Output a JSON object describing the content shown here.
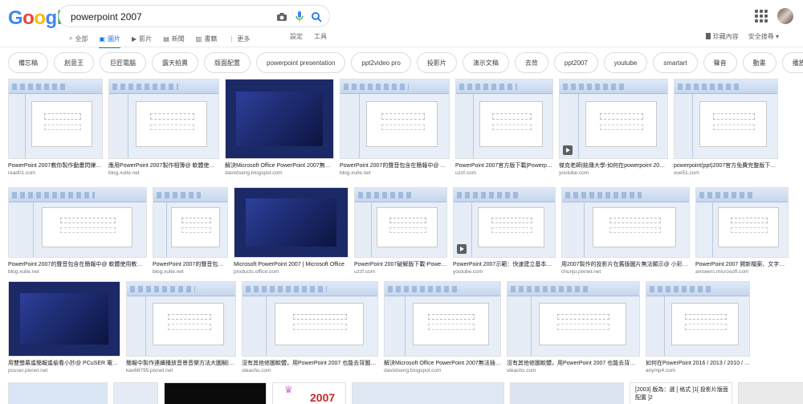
{
  "search": {
    "query": "powerpoint 2007"
  },
  "logo": {
    "letters": [
      "G",
      "o",
      "o",
      "g",
      "l",
      "e"
    ],
    "colors": [
      "#4285f4",
      "#ea4335",
      "#fbbc05",
      "#4285f4",
      "#34a853",
      "#ea4335"
    ]
  },
  "tabs": [
    {
      "label": "全部",
      "icon": "search-icon",
      "active": false
    },
    {
      "label": "圖片",
      "icon": "image-icon",
      "active": true
    },
    {
      "label": "影片",
      "icon": "video-icon",
      "active": false
    },
    {
      "label": "新聞",
      "icon": "news-icon",
      "active": false
    },
    {
      "label": "書籍",
      "icon": "book-icon",
      "active": false
    },
    {
      "label": "更多",
      "icon": "more-icon",
      "active": false
    }
  ],
  "tools": {
    "settings": "設定",
    "tools": "工具"
  },
  "right_links": {
    "saved": "珍藏內容",
    "safesearch": "安全搜尋"
  },
  "chips": [
    "備忘稿",
    "創意王",
    "巨匠電腦",
    "露天拍賣",
    "版面配置",
    "powerpoint presentation",
    "ppt2video pro",
    "投影片",
    "演示文稿",
    "去背",
    "ppt2007",
    "youtube",
    "smartart",
    "聲音",
    "動畫",
    "播放"
  ],
  "rows": [
    [
      {
        "caption": "PowerPoint 2007教你製作動畫閃爍...",
        "source": "read01.com"
      },
      {
        "caption": "應用PowerPoint 2007製作相簿@ 軟體使用教...",
        "source": "blog.xuite.net"
      },
      {
        "caption": "解決Microsoft Office PowerPoint 2007無法...",
        "source": "davistseng.blogspot.com"
      },
      {
        "caption": "PowerPoint 2007的聲音包含在簡報中@ 軟...",
        "source": "blog.xuite.net"
      },
      {
        "caption": "PowerPoint 2007官方版下載|Powerpoint...",
        "source": "uzzf.com"
      },
      {
        "caption": "傑克老師|銘傳大學-如何在powerpoint 2007...",
        "source": "youtube.com"
      },
      {
        "caption": "powerpoint(ppt)2007官方免費完整版下載(附...",
        "source": "xue51.com"
      }
    ],
    [
      {
        "caption": "PowerPoint 2007的聲音包含在簡報中@ 軟體使用教學: ...",
        "source": "blog.xuite.net"
      },
      {
        "caption": "PowerPoint 2007的聲音包含...",
        "source": "blog.xuite.net"
      },
      {
        "caption": "Microsoft PowerPoint 2007 | Microsoft Office",
        "source": "products.office.com"
      },
      {
        "caption": "PowerPoint 2007破解版下載-Powerp...",
        "source": "uzzf.com"
      },
      {
        "caption": "PowerPoint 2007示範：快速建立基本簡...",
        "source": "youtube.com"
      },
      {
        "caption": "用2007製作的投影片在舊版圖片無法顯示@ 小彩的網...",
        "source": "chunju.pixnet.net"
      },
      {
        "caption": "PowerPoint 2007 開新檔案、文字會...",
        "source": "answers.microsoft.com"
      }
    ],
    [
      {
        "caption": "用雙螢幕遙簡報遙偷看小抄@ PCuSER 電腦人: ...",
        "source": "pcuser.pixnet.net"
      },
      {
        "caption": "簡報中製作連續播放音景音樂方法大圖解|Power...",
        "source": "kav68795.pixnet.net"
      },
      {
        "caption": "沒有其他修圖軟體，用PowerPoint 2007 也能去背圖片？...",
        "source": "steachs.com"
      },
      {
        "caption": "解決Microsoft Office PowerPoint 2007無法插入...",
        "source": "davistseng.blogspot.com"
      },
      {
        "caption": "沒有其他修圖軟體，用PowerPoint 2007 也能去背圖片？...",
        "source": "steachs.com"
      },
      {
        "caption": "如何在PowerPoint 2016 / 2013 / 2010 / 2007中錄...",
        "source": "anymp4.com"
      }
    ]
  ],
  "row4_texts": {
    "a": "2007",
    "b": "[2003] 版為：選 [ 格式 ]1[ 投影片版面配置 ]2"
  }
}
